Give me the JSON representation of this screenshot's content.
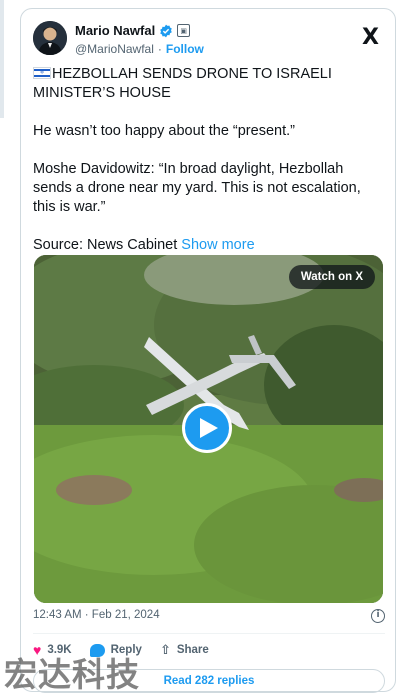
{
  "author": {
    "display_name": "Mario Nawfal",
    "handle": "@MarioNawfal",
    "separator": "·",
    "follow_label": "Follow",
    "verified_color": "#1d9bf0",
    "avatar_icon": "user-avatar"
  },
  "brand": {
    "logo": "X"
  },
  "post": {
    "headline": "HEZBOLLAH SENDS DRONE TO ISRAELI MINISTER’S HOUSE",
    "line2": "He wasn’t too happy about the “present.”",
    "quote": "Moshe Davidowitz: “In broad daylight, Hezbollah sends a drone near my yard. This is not escalation, this is war.”",
    "source": "Source: News Cabinet",
    "show_more": "Show more"
  },
  "media": {
    "watch_label": "Watch on X",
    "play_icon": "play-icon"
  },
  "meta": {
    "timestamp": "12:43 AM · Feb 21, 2024",
    "info_icon": "info-icon"
  },
  "actions": {
    "like_count": "3.9K",
    "reply_label": "Reply",
    "share_label": "Share"
  },
  "replies_button": "Read 282 replies",
  "watermark": "宏达科技",
  "colors": {
    "accent": "#1d9bf0",
    "like": "#f91880",
    "text": "#0f1419",
    "muted": "#536471"
  }
}
